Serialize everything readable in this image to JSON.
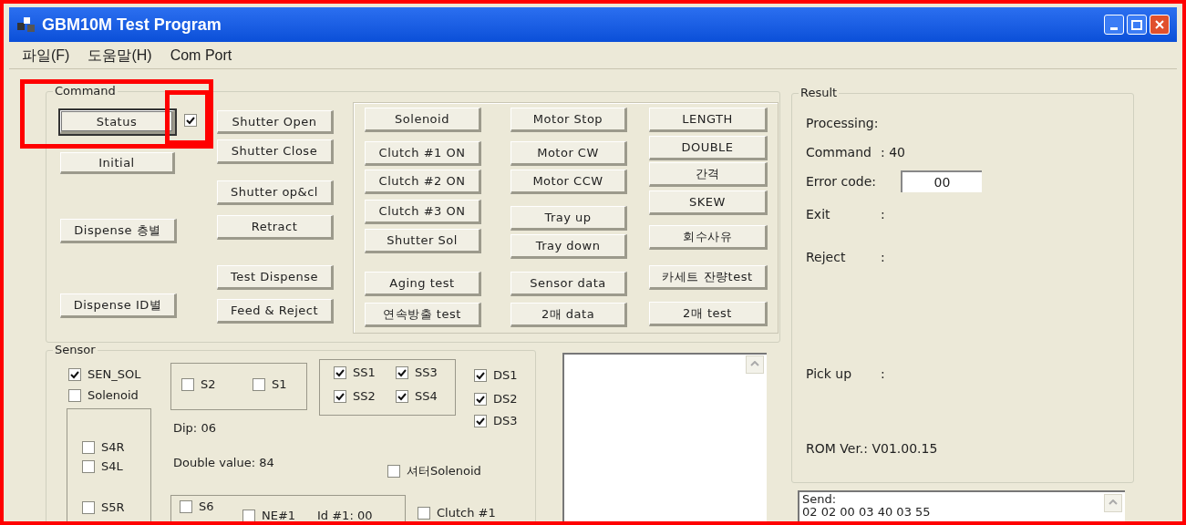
{
  "window": {
    "title": "GBM10M Test Program"
  },
  "menu": [
    "파일(F)",
    "도움말(H)",
    "Com Port"
  ],
  "command": {
    "title": "Command",
    "status_checkbox": {
      "checked": true
    },
    "buttons": [
      {
        "label": "Status",
        "focused": true
      },
      {
        "label": "Shutter Open",
        "focused": false
      },
      {
        "label": "Shutter Close",
        "focused": false
      },
      {
        "label": "Initial",
        "focused": false
      },
      {
        "label": "Shutter op&cl",
        "focused": false
      },
      {
        "label": "Dispense 층별",
        "focused": false
      },
      {
        "label": "Retract",
        "focused": false
      },
      {
        "label": "Test Dispense",
        "focused": false
      },
      {
        "label": "Dispense ID별",
        "focused": false
      },
      {
        "label": "Feed & Reject",
        "focused": false
      }
    ],
    "panel_columns": [
      [
        "Solenoid",
        "Clutch #1 ON",
        "Clutch #2 ON",
        "Clutch #3 ON",
        "Shutter Sol",
        "Aging test",
        "연속방출 test"
      ],
      [
        "Motor Stop",
        "Motor CW",
        "Motor CCW",
        "Tray up",
        "Tray down",
        "Sensor data",
        "2매 data"
      ],
      [
        "LENGTH",
        "DOUBLE",
        "간격",
        "SKEW",
        "회수사유",
        "카세트 잔량test",
        "2매 test"
      ]
    ]
  },
  "result": {
    "title": "Result",
    "rows": [
      {
        "kind": "text",
        "label": "Processing:"
      },
      {
        "kind": "text",
        "label": "Command",
        "value": ": 40"
      },
      {
        "kind": "field",
        "label": "Error code:",
        "value": "00"
      },
      {
        "kind": "text",
        "label": "Exit",
        "value": ":"
      },
      {
        "kind": "text",
        "label": "Reject",
        "value": ":"
      },
      {
        "kind": "text",
        "label": "Pick up",
        "value": ":"
      },
      {
        "kind": "text",
        "label": "ROM Ver.: V01.00.15"
      }
    ]
  },
  "send_log": [
    "Send:",
    "02 02 00 03 40 03 55"
  ],
  "sensor": {
    "title": "Sensor",
    "checkboxes": [
      {
        "label": "SEN_SOL",
        "checked": true
      },
      {
        "label": "Solenoid",
        "checked": false
      },
      {
        "label": "S4R",
        "checked": false
      },
      {
        "label": "S4L",
        "checked": false
      },
      {
        "label": "S5R",
        "checked": false
      },
      {
        "label": "S2",
        "checked": false
      },
      {
        "label": "S1",
        "checked": false
      },
      {
        "label": "SS1",
        "checked": true
      },
      {
        "label": "SS3",
        "checked": true
      },
      {
        "label": "SS2",
        "checked": true
      },
      {
        "label": "SS4",
        "checked": true
      },
      {
        "label": "DS1",
        "checked": true
      },
      {
        "label": "DS2",
        "checked": true
      },
      {
        "label": "DS3",
        "checked": true
      },
      {
        "label": "셔터Solenoid",
        "checked": false
      },
      {
        "label": "S6",
        "checked": false
      },
      {
        "label": "NE#1",
        "checked": false
      },
      {
        "label": "Clutch #1",
        "checked": false
      }
    ],
    "texts": [
      "Dip: 06",
      "Double value: 84",
      "Id #1: 00"
    ]
  }
}
